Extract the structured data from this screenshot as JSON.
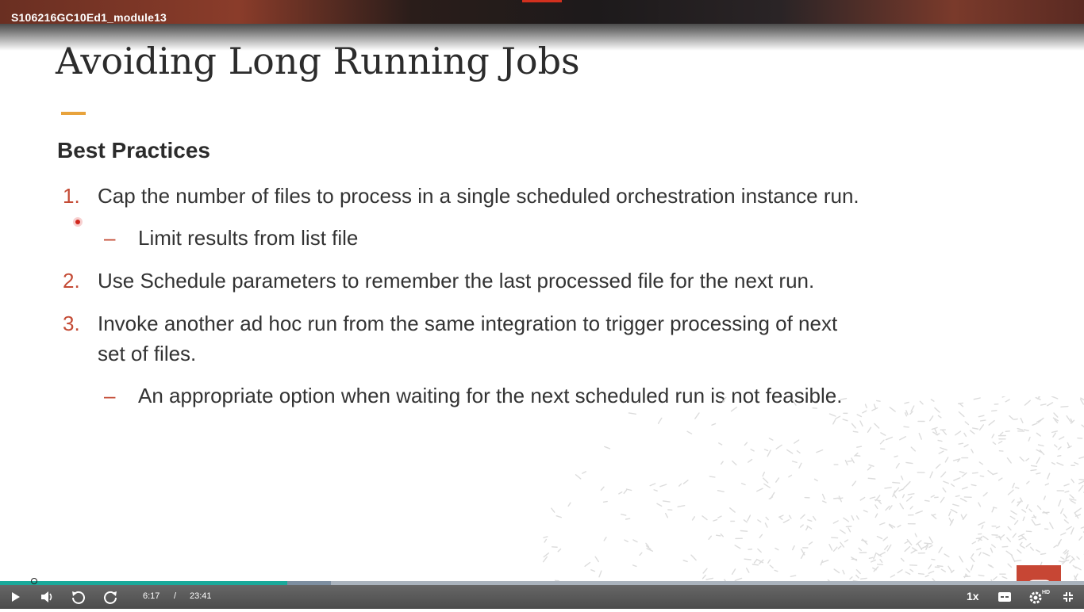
{
  "header": {
    "module_title": "S106216GC10Ed1_module13"
  },
  "slide": {
    "title": "Avoiding Long Running Jobs",
    "section_heading": "Best Practices",
    "items": [
      {
        "number": "1.",
        "text": "Cap the number of files to process in a single scheduled orchestration instance run.",
        "subitems": [
          {
            "bullet": "–",
            "text": "Limit results from list file"
          }
        ]
      },
      {
        "number": "2.",
        "text": "Use Schedule parameters to remember the last processed file for the next run.",
        "subitems": []
      },
      {
        "number": "3.",
        "line1": "Invoke another ad hoc run from the same integration to trigger processing of next",
        "line2": "set of files.",
        "subitems": [
          {
            "bullet": "–",
            "text": "An appropriate option when waiting for the next scheduled run is not feasible."
          }
        ]
      }
    ]
  },
  "player": {
    "current_time": "6:17",
    "separator": "/",
    "duration": "23:41",
    "speed": "1x",
    "progress_fraction": 0.265,
    "buffered_fraction": 0.305,
    "icons": [
      "play-icon",
      "volume-icon",
      "rewind-icon",
      "forward-icon",
      "captions-icon",
      "settings-icon",
      "exit-fullscreen-icon"
    ],
    "hd_badge": "HD"
  },
  "colors": {
    "accent_orange": "#e8a33c",
    "number_red": "#c44b35",
    "progress_teal": "#1aa99a",
    "oracle_red": "#c74634"
  }
}
